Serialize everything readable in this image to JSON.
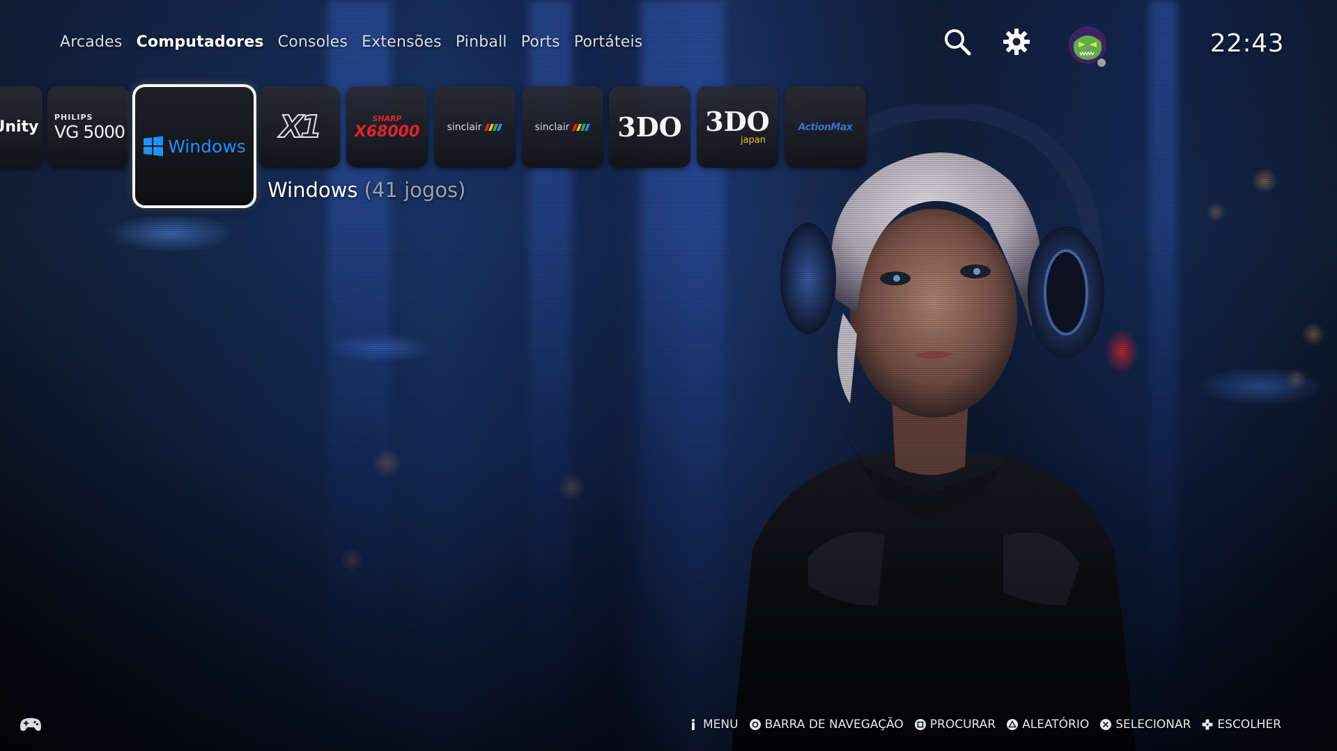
{
  "nav": {
    "items": [
      {
        "label": "Arcades",
        "active": false
      },
      {
        "label": "Computadores",
        "active": true
      },
      {
        "label": "Consoles",
        "active": false
      },
      {
        "label": "Extensões",
        "active": false
      },
      {
        "label": "Pinball",
        "active": false
      },
      {
        "label": "Ports",
        "active": false
      },
      {
        "label": "Portáteis",
        "active": false
      }
    ]
  },
  "header": {
    "search_icon": "search-icon",
    "settings_icon": "gear-icon",
    "avatar": "avatar-monster",
    "clock": "22:43"
  },
  "systems": {
    "tiles": [
      {
        "logo": "Unity"
      },
      {
        "logo_top": "PHILIPS",
        "logo_main": "VG 5000"
      },
      {
        "logo": "Windows",
        "selected": true
      },
      {
        "logo": "X1"
      },
      {
        "logo_top": "SHARP",
        "logo_main": "X68000"
      },
      {
        "logo": "sinclair"
      },
      {
        "logo": "sinclair"
      },
      {
        "logo": "3DO"
      },
      {
        "logo": "3DO",
        "logo_sub": "japan"
      },
      {
        "logo": "ActionMax"
      }
    ],
    "selected_name": "Windows",
    "selected_count": "(41 jogos)"
  },
  "help_bar": {
    "controller_icon": "gamepad-icon",
    "items": [
      {
        "icon": "info-icon",
        "label": "MENU"
      },
      {
        "icon": "circle-button-icon",
        "label": "BARRA DE NAVEGAÇÃO"
      },
      {
        "icon": "square-button-icon",
        "label": "PROCURAR"
      },
      {
        "icon": "triangle-button-icon",
        "label": "ALEATÓRIO"
      },
      {
        "icon": "cross-button-icon",
        "label": "SELECIONAR"
      },
      {
        "icon": "dpad-icon",
        "label": "ESCOLHER"
      }
    ]
  },
  "colors": {
    "accent": "#ffffff",
    "windows_blue": "#1e90ff",
    "sharp_red": "#e0242a",
    "muted_text": "#9aa3ad"
  }
}
